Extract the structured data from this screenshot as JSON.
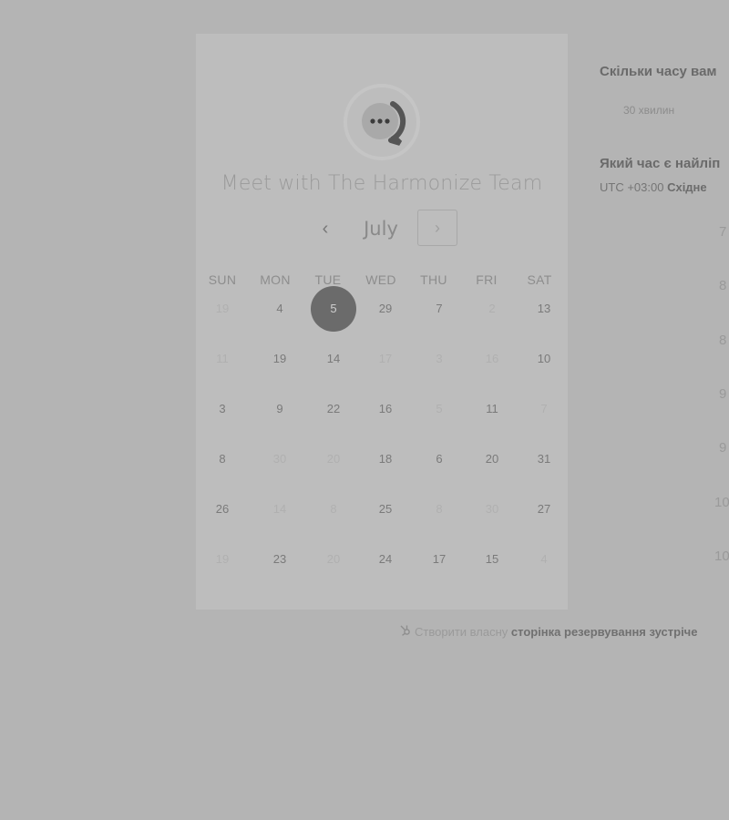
{
  "calendar": {
    "title": "Meet with The Harmonize Team",
    "month": "July",
    "prev_label": "‹",
    "next_label": "›",
    "weekdays": [
      "SUN",
      "MON",
      "TUE",
      "WED",
      "THU",
      "FRI",
      "SAT"
    ],
    "weeks": [
      [
        {
          "d": "19",
          "s": "dim"
        },
        {
          "d": "4",
          "s": "avail"
        },
        {
          "d": "5",
          "s": "selected"
        },
        {
          "d": "29",
          "s": "avail"
        },
        {
          "d": "7",
          "s": "avail"
        },
        {
          "d": "2",
          "s": "dim"
        },
        {
          "d": "13",
          "s": "avail"
        }
      ],
      [
        {
          "d": "11",
          "s": "dim"
        },
        {
          "d": "19",
          "s": "avail"
        },
        {
          "d": "14",
          "s": "avail"
        },
        {
          "d": "17",
          "s": "dim"
        },
        {
          "d": "3",
          "s": "dim"
        },
        {
          "d": "16",
          "s": "dim"
        },
        {
          "d": "10",
          "s": "avail"
        }
      ],
      [
        {
          "d": "3",
          "s": "avail"
        },
        {
          "d": "9",
          "s": "avail"
        },
        {
          "d": "22",
          "s": "avail"
        },
        {
          "d": "16",
          "s": "avail"
        },
        {
          "d": "5",
          "s": "dim"
        },
        {
          "d": "11",
          "s": "avail"
        },
        {
          "d": "7",
          "s": "dim"
        }
      ],
      [
        {
          "d": "8",
          "s": "avail"
        },
        {
          "d": "30",
          "s": "dim"
        },
        {
          "d": "20",
          "s": "dim"
        },
        {
          "d": "18",
          "s": "avail"
        },
        {
          "d": "6",
          "s": "avail"
        },
        {
          "d": "20",
          "s": "avail"
        },
        {
          "d": "31",
          "s": "avail"
        }
      ],
      [
        {
          "d": "26",
          "s": "avail"
        },
        {
          "d": "14",
          "s": "dim"
        },
        {
          "d": "8",
          "s": "dim"
        },
        {
          "d": "25",
          "s": "avail"
        },
        {
          "d": "8",
          "s": "dim"
        },
        {
          "d": "30",
          "s": "dim"
        },
        {
          "d": "27",
          "s": "avail"
        }
      ],
      [
        {
          "d": "19",
          "s": "dim"
        },
        {
          "d": "23",
          "s": "avail"
        },
        {
          "d": "20",
          "s": "dim"
        },
        {
          "d": "24",
          "s": "avail"
        },
        {
          "d": "17",
          "s": "avail"
        },
        {
          "d": "15",
          "s": "avail"
        },
        {
          "d": "4",
          "s": "dim"
        }
      ]
    ]
  },
  "side": {
    "duration_question": "Скільки часу вам",
    "duration_option": "30 хвилин",
    "time_question": "Який час є найліп",
    "timezone_prefix": "UTC +03:00",
    "timezone_name": "Східне",
    "time_slots": [
      "7",
      "8",
      "8",
      "9",
      "9",
      "10",
      "10"
    ]
  },
  "footer": {
    "text": "Створити власну",
    "link": "сторінка резервування зустріче"
  },
  "colors": {
    "overlay_bg": "#b4b4b4",
    "card_bg": "#bdbdbd",
    "selected_day": "#6b6b6b"
  }
}
